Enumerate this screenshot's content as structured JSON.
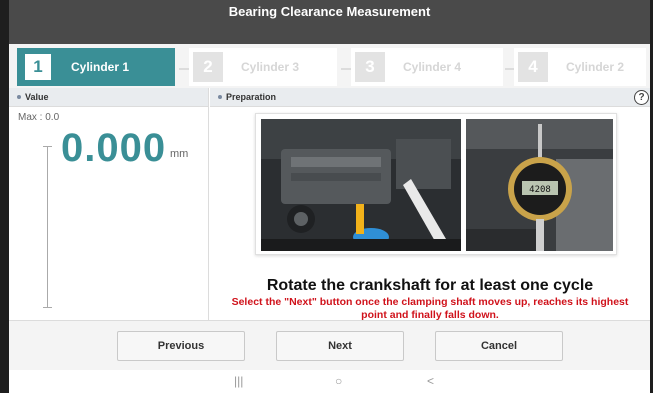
{
  "window": {
    "title": "Bearing Clearance Measurement"
  },
  "steps": [
    {
      "number": "1",
      "label": "Cylinder 1",
      "active": true
    },
    {
      "number": "2",
      "label": "Cylinder 3",
      "active": false
    },
    {
      "number": "3",
      "label": "Cylinder 4",
      "active": false
    },
    {
      "number": "4",
      "label": "Cylinder 2",
      "active": false
    }
  ],
  "value_panel": {
    "header": "Value",
    "max_label": "Max : 0.0",
    "value": "0.000",
    "unit": "mm"
  },
  "preparation_panel": {
    "header": "Preparation",
    "help_label": "?",
    "gauge_reading": "4208",
    "instruction_title": "Rotate the crankshaft for at least one cycle",
    "instruction_detail": "Select the \"Next\" button once the clamping shaft moves up, reaches its highest point and finally falls down."
  },
  "buttons": {
    "previous": "Previous",
    "next": "Next",
    "cancel": "Cancel"
  },
  "android_nav": {
    "recents": "|||",
    "home": "○",
    "back": "<"
  },
  "colors": {
    "accent": "#3a8f96",
    "title_bar": "#4a4a4a",
    "warning_text": "#d0121b"
  }
}
